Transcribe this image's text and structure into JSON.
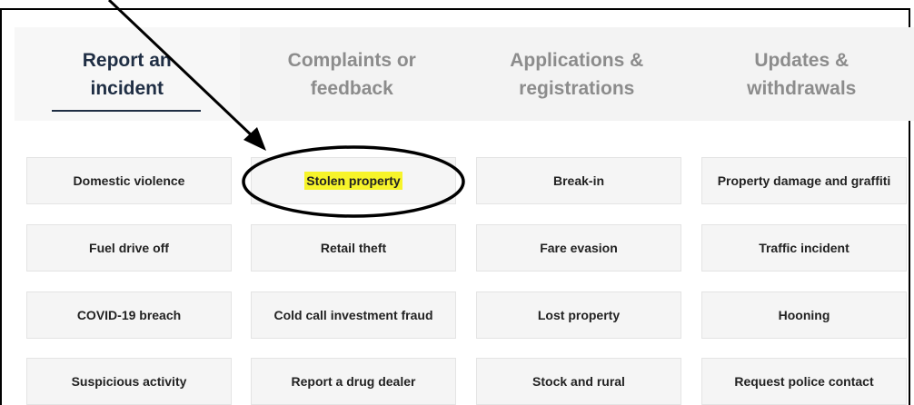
{
  "tabs": [
    {
      "label": "Report an incident",
      "active": true
    },
    {
      "label": "Complaints or feedback",
      "active": false
    },
    {
      "label": "Applications & registrations",
      "active": false
    },
    {
      "label": "Updates & withdrawals",
      "active": false
    }
  ],
  "incident_types": [
    [
      "Domestic violence",
      "Stolen property",
      "Break-in",
      "Property damage and graffiti"
    ],
    [
      "Fuel drive off",
      "Retail theft",
      "Fare evasion",
      "Traffic incident"
    ],
    [
      "COVID-19 breach",
      "Cold call investment fraud",
      "Lost property",
      "Hooning"
    ],
    [
      "Suspicious activity",
      "Report a drug dealer",
      "Stock and rural",
      "Request police contact"
    ]
  ],
  "highlighted_item": "Stolen property",
  "colors": {
    "active_tab_text": "#1f2e44",
    "inactive_tab_text": "#8c8c8c",
    "highlight": "#f7f42a",
    "annotation": "#000000"
  }
}
